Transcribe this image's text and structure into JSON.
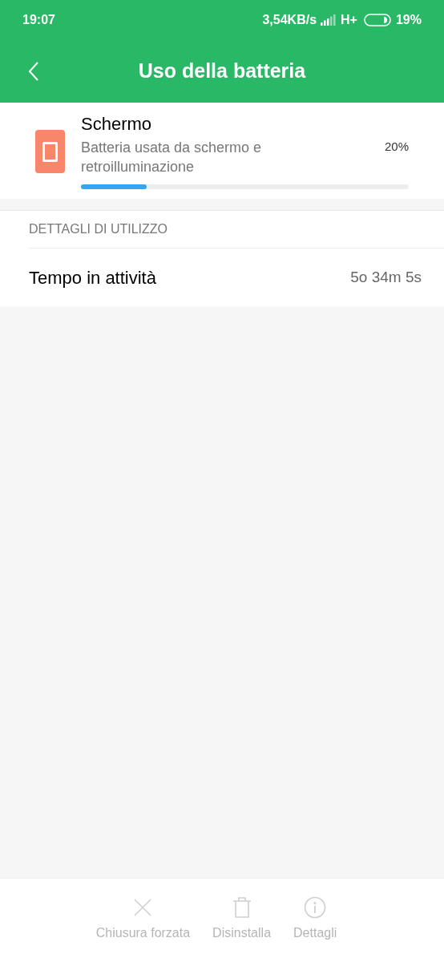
{
  "status_bar": {
    "time": "19:07",
    "speed": "3,54KB/s",
    "network": "H+",
    "battery": "19%"
  },
  "header": {
    "title": "Uso della batteria"
  },
  "app": {
    "name": "Schermo",
    "description": "Batteria usata da schermo e retroilluminazione",
    "percent": "20%",
    "level": 0.2
  },
  "details": {
    "heading": "DETTAGLI DI UTILIZZO",
    "rows": [
      {
        "label": "Tempo in attività",
        "value": "5o 34m 5s"
      }
    ]
  },
  "actions": [
    {
      "kind": "close",
      "label": "Chiusura forzata",
      "disabled": true
    },
    {
      "kind": "trash",
      "label": "Disinstalla",
      "disabled": true
    },
    {
      "kind": "info",
      "label": "Dettagli",
      "disabled": true
    }
  ]
}
